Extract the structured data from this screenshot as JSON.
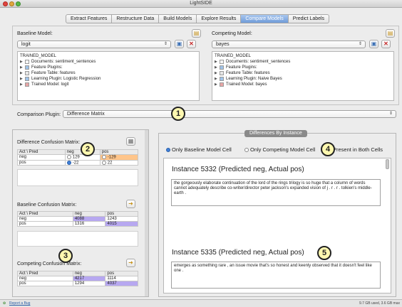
{
  "app": {
    "title": "LightSIDE"
  },
  "tabs": [
    {
      "label": "Extract Features"
    },
    {
      "label": "Restructure Data"
    },
    {
      "label": "Build Models"
    },
    {
      "label": "Explore Results"
    },
    {
      "label": "Compare Models"
    },
    {
      "label": "Predict Labels"
    }
  ],
  "baseline": {
    "label": "Baseline Model:",
    "selected": "logit",
    "tree": [
      "TRAINED_MODEL",
      "Documents: sentiment_sentences",
      "Feature Plugins:",
      "Feature Table: features",
      "Learning Plugin: Logistic Regression",
      "Trained Model: logit"
    ]
  },
  "competing": {
    "label": "Competing Model:",
    "selected": "bayes",
    "tree": [
      "TRAINED_MODEL",
      "Documents: sentiment_sentences",
      "Feature Plugins:",
      "Feature Table: features",
      "Learning Plugin: Naive Bayes",
      "Trained Model: bayes"
    ]
  },
  "comparison": {
    "label": "Comparison Plugin:",
    "selected": "Difference Matrix"
  },
  "callouts": [
    "1",
    "2",
    "3",
    "4",
    "5"
  ],
  "diff_matrix": {
    "title": "Difference Confusion Matrix:",
    "header": [
      "Act \\ Pred",
      "neg",
      "pos"
    ],
    "rows": [
      {
        "label": "neg",
        "a": "129",
        "b": "-129"
      },
      {
        "label": "pos",
        "a": "-22",
        "b": "22"
      }
    ]
  },
  "baseline_matrix": {
    "title": "Baseline Confusion Matrix:",
    "header": [
      "Act \\ Pred",
      "neg",
      "pos"
    ],
    "rows": [
      {
        "label": "neg",
        "a": "4088",
        "b": "1243"
      },
      {
        "label": "pos",
        "a": "1316",
        "b": "4015"
      }
    ]
  },
  "competing_matrix": {
    "title": "Competing Confusion Matrix:",
    "header": [
      "Act \\ Pred",
      "neg",
      "pos"
    ],
    "rows": [
      {
        "label": "neg",
        "a": "4217",
        "b": "1114"
      },
      {
        "label": "pos",
        "a": "1294",
        "b": "4037"
      }
    ]
  },
  "differences": {
    "section_title": "Differences By Instance",
    "options": [
      "Only Baseline Model Cell",
      "Only Competing Model Cell",
      "Present in Both Cells"
    ],
    "instances": [
      {
        "title": "Instance 5332 (Predicted neg, Actual pos)",
        "text": "the gorgeously elaborate continuation of the lord of the rings trilogy is so huge that a column of words cannot adequately describe co-writer/director peter jackson's expanded vision of j . r . r . tolkien's middle-earth ."
      },
      {
        "title": "Instance 5335 (Predicted neg, Actual pos)",
        "text": "emerges as something rare , an issue movie that's so honest and keenly observed that it doesn't feel like one ."
      }
    ]
  },
  "status": {
    "report": "Report a Bug",
    "memory": "9.7 GB used, 3.6 GB max"
  },
  "colors": {
    "accent": "#6f9bd8",
    "cell_purple": "#b7a8f0",
    "cell_orange": "#ffc58a",
    "callout": "#fff8b0"
  }
}
